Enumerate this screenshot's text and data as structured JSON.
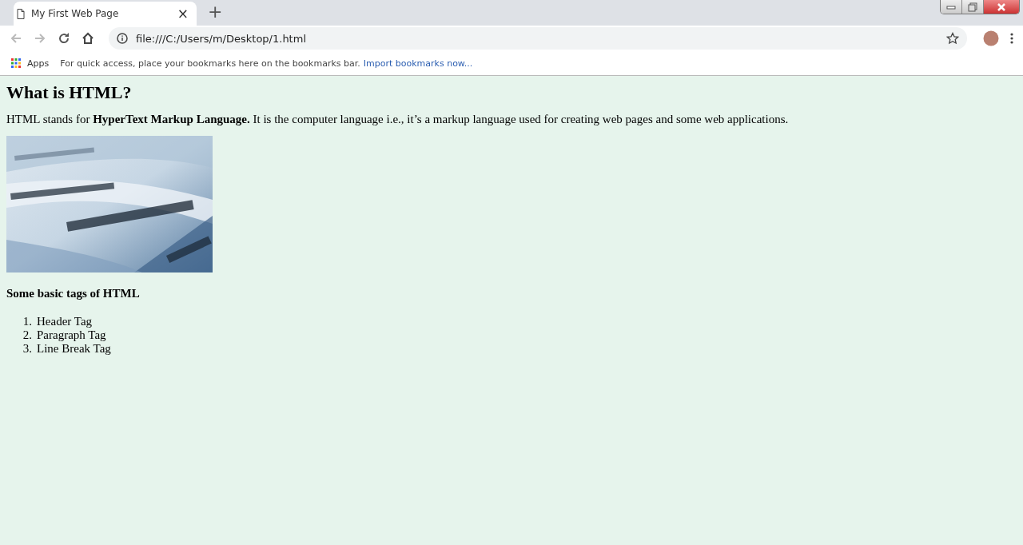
{
  "tab": {
    "title": "My First Web Page",
    "close": "×",
    "new_tab": "+"
  },
  "address": {
    "value": "file:///C:/Users/m/Desktop/1.html"
  },
  "bookmarks": {
    "apps": "Apps",
    "hint": "For quick access, place your bookmarks here on the bookmarks bar.",
    "link": "Import bookmarks now..."
  },
  "page": {
    "heading": "What is HTML?",
    "paragraph": "HTML stands for **HyperText Markup Language.** It is the computer language i.e., it’s a markup language used for creating web pages and some web applications.",
    "subheading": "Some basic tags of HTML",
    "list": [
      {
        "number": "1.",
        "text": "Header Tag"
      },
      {
        "number": "2.",
        "text": "Paragraph Tag"
      },
      {
        "number": "3.",
        "text": "Line Break Tag"
      }
    ]
  }
}
